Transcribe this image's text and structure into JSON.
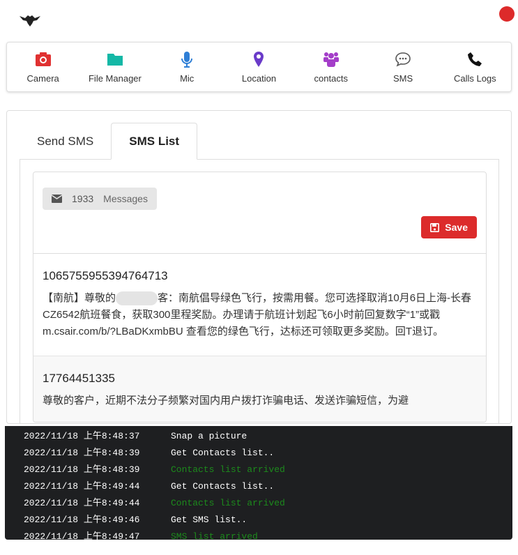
{
  "toolbar": {
    "items": [
      {
        "label": "Camera",
        "icon": "camera-icon",
        "color": "#e03131"
      },
      {
        "label": "File Manager",
        "icon": "folder-icon",
        "color": "#14b8a6"
      },
      {
        "label": "Mic",
        "icon": "mic-icon",
        "color": "#2f7fd6"
      },
      {
        "label": "Location",
        "icon": "map-pin-icon",
        "color": "#6a3bc9"
      },
      {
        "label": "contacts",
        "icon": "users-icon",
        "color": "#a43ec9"
      },
      {
        "label": "SMS",
        "icon": "chat-icon",
        "color": "#555555"
      },
      {
        "label": "Calls Logs",
        "icon": "phone-icon",
        "color": "#111111"
      }
    ]
  },
  "tabs": [
    {
      "label": "Send SMS"
    },
    {
      "label": "SMS List",
      "active": true
    }
  ],
  "sms": {
    "count": "1933",
    "count_label": "Messages",
    "save_label": "Save",
    "messages": [
      {
        "number": "1065755955394764713",
        "text_a": "【南航】尊敬的",
        "text_b": "客：南航倡导绿色飞行，按需用餐。您可选择取消10月6日上海-长春CZ6542航班餐食，获取300里程奖励。办理请于航班计划起飞6小时前回复数字“1”或戳 m.csair.com/b/?LBaDKxmbBU 查看您的绿色飞行，达标还可领取更多奖励。回T退订。"
      },
      {
        "number": "17764451335",
        "text_a": "尊敬的客户，近期不法分子频繁对国内用户拨打诈骗电话、发送诈骗短信，为避",
        "text_b": ""
      }
    ]
  },
  "log": [
    {
      "time": "2022/11/18 上午8:48:37",
      "text": "Snap a picture",
      "status": "info"
    },
    {
      "time": "2022/11/18 上午8:48:39",
      "text": "Get Contacts list..",
      "status": "info"
    },
    {
      "time": "2022/11/18 上午8:48:39",
      "text": "Contacts list arrived",
      "status": "success"
    },
    {
      "time": "2022/11/18 上午8:49:44",
      "text": "Get Contacts list..",
      "status": "info"
    },
    {
      "time": "2022/11/18 上午8:49:44",
      "text": "Contacts list arrived",
      "status": "success"
    },
    {
      "time": "2022/11/18 上午8:49:46",
      "text": "Get SMS list..",
      "status": "info"
    },
    {
      "time": "2022/11/18 上午8:49:47",
      "text": "SMS list arrived",
      "status": "success"
    }
  ]
}
